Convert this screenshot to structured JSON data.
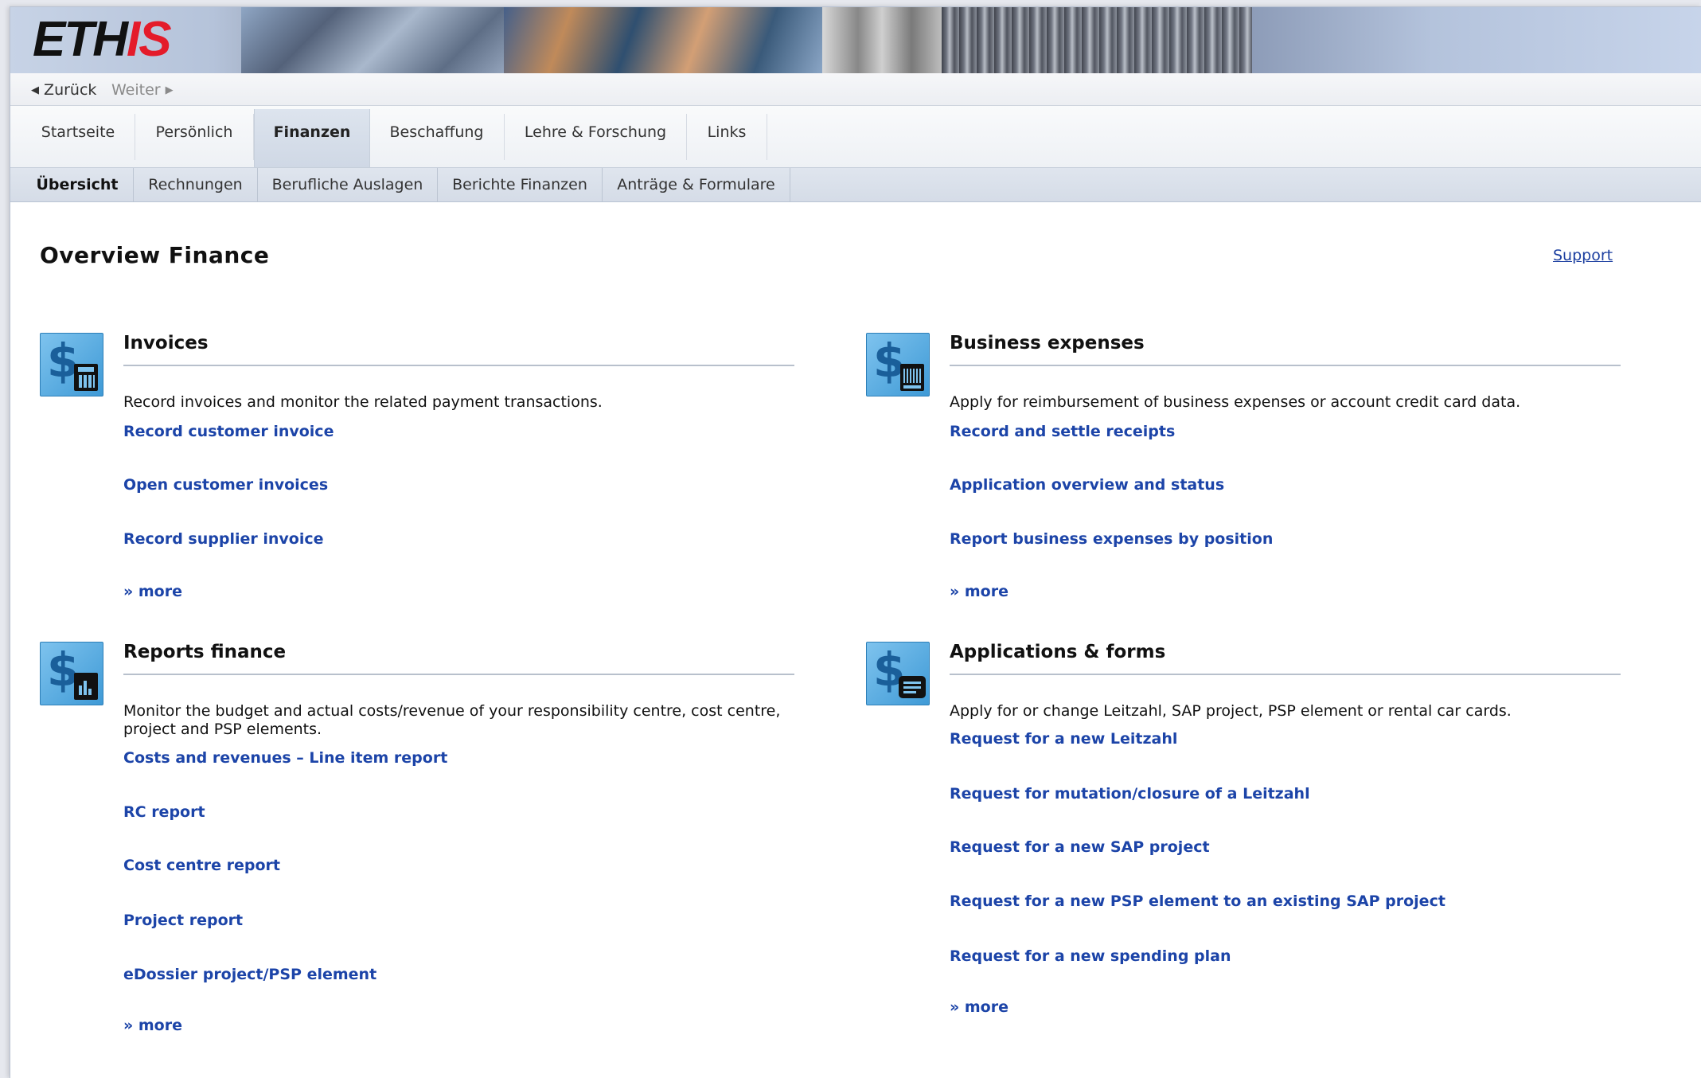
{
  "logo": {
    "part1": "ETH",
    "part2": "IS"
  },
  "nav": {
    "back": "Zurück",
    "forward": "Weiter"
  },
  "tabs": [
    {
      "label": "Startseite"
    },
    {
      "label": "Persönlich"
    },
    {
      "label": "Finanzen"
    },
    {
      "label": "Beschaffung"
    },
    {
      "label": "Lehre & Forschung"
    },
    {
      "label": "Links"
    }
  ],
  "active_tab": "Finanzen",
  "subtabs": [
    {
      "label": "Übersicht"
    },
    {
      "label": "Rechnungen"
    },
    {
      "label": "Berufliche Auslagen"
    },
    {
      "label": "Berichte Finanzen"
    },
    {
      "label": "Anträge & Formulare"
    }
  ],
  "active_subtab": "Übersicht",
  "page": {
    "title": "Overview Finance",
    "support": "Support"
  },
  "sections": {
    "invoices": {
      "title": "Invoices",
      "icon": "dollar-calculator-icon",
      "description": "Record invoices and monitor the related payment transactions.",
      "links": [
        "Record customer invoice",
        "Open customer invoices",
        "Record supplier invoice",
        "» more"
      ]
    },
    "business_expenses": {
      "title": "Business expenses",
      "icon": "dollar-barcode-icon",
      "description": "Apply for reimbursement of business expenses or account credit card data.",
      "links": [
        "Record and settle receipts",
        "Application overview and status",
        "Report business expenses by position",
        "» more"
      ]
    },
    "reports_finance": {
      "title": "Reports finance",
      "icon": "dollar-report-icon",
      "description": "Monitor the budget and actual costs/revenue of your responsibility centre, cost centre, project and PSP elements.",
      "links": [
        "Costs and revenues – Line item report",
        "RC report",
        "Cost centre report",
        "Project report",
        "eDossier project/PSP element",
        "» more"
      ]
    },
    "applications_forms": {
      "title": "Applications & forms",
      "icon": "dollar-form-icon",
      "description": "Apply for or change Leitzahl, SAP project, PSP element or rental car cards.",
      "links": [
        "Request for a new Leitzahl",
        "Request for mutation/closure of a Leitzahl",
        "Request for a new SAP project",
        "Request for a new PSP element to an existing SAP project",
        "Request for a new spending plan",
        "» more"
      ]
    }
  }
}
